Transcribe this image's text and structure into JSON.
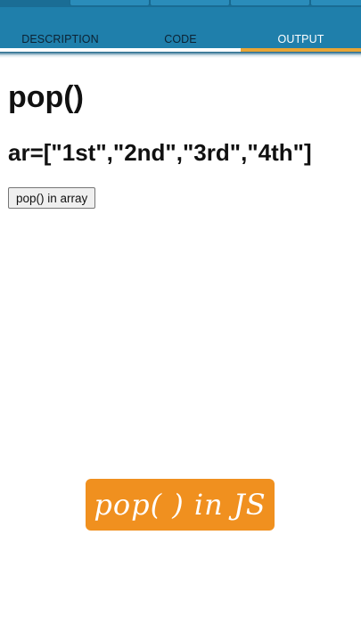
{
  "tabs": [
    {
      "label": "DESCRIPTION"
    },
    {
      "label": "CODE"
    },
    {
      "label": "OUTPUT"
    }
  ],
  "active_tab_index": 2,
  "output": {
    "title": "pop()",
    "array_text": "ar=[\"1st\",\"2nd\",\"3rd\",\"4th\"]",
    "button_label": "pop() in array"
  },
  "badge": {
    "text": "pop( ) in JS"
  },
  "colors": {
    "header": "#1f7fab",
    "active_indicator": "#e8a535",
    "badge": "#f0901f"
  }
}
